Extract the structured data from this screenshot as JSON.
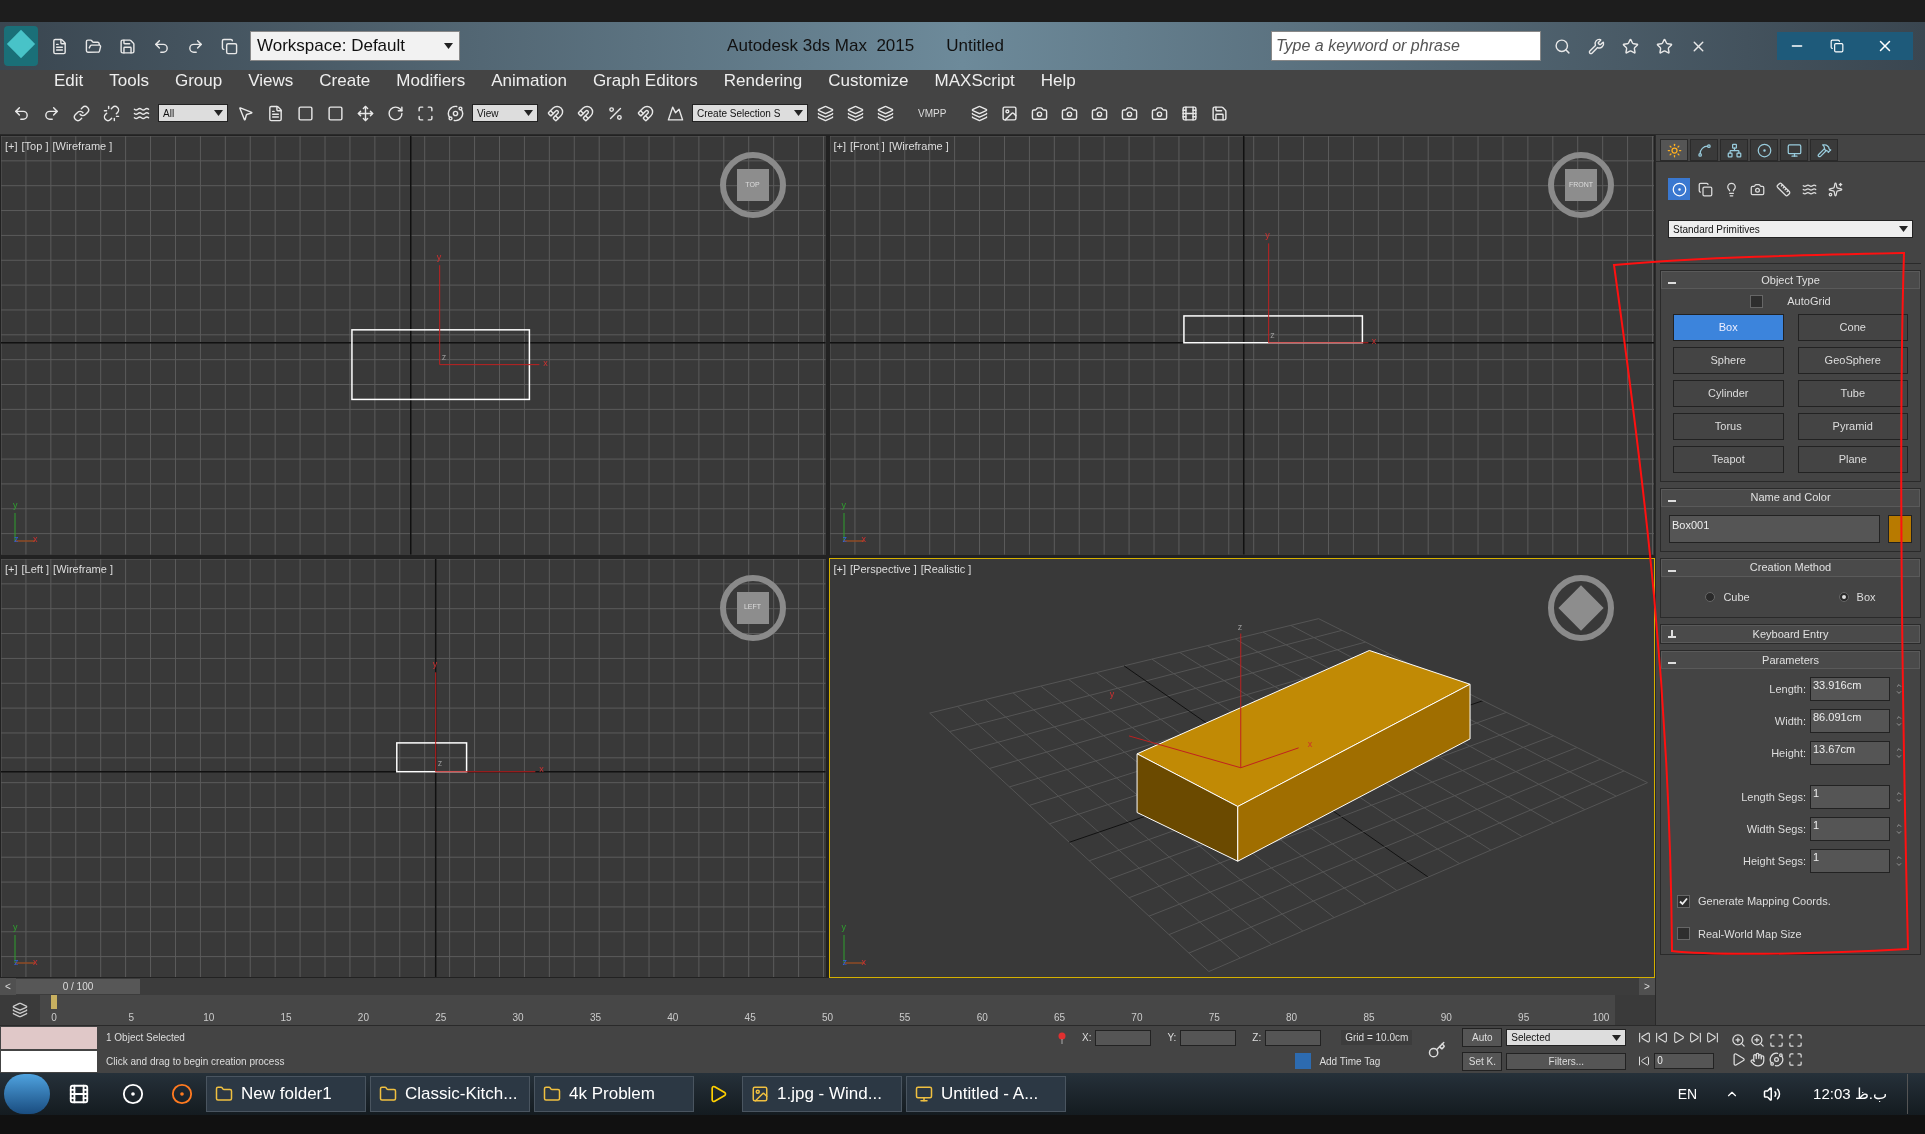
{
  "title_bar": {
    "workspace": "Workspace: Default",
    "app": "Autodesk 3ds Max  2015",
    "document": "Untitled",
    "search": {
      "placeholder": "Type a keyword or phrase"
    }
  },
  "menu": [
    "Edit",
    "Tools",
    "Group",
    "Views",
    "Create",
    "Modifiers",
    "Animation",
    "Graph Editors",
    "Rendering",
    "Customize",
    "MAXScript",
    "Help"
  ],
  "toolbar": {
    "filter": "All",
    "coord": "View",
    "selection_set": "Create Selection S",
    "vmpp": "VMPP"
  },
  "viewports": [
    {
      "kind": "top",
      "labels": [
        "[+]",
        "[Top ]",
        "[Wireframe ]"
      ],
      "cube": "TOP",
      "gizmo_labels": [
        "x",
        "y",
        "z"
      ],
      "corner_labels": [
        "x",
        "y",
        "z"
      ],
      "selected": false
    },
    {
      "kind": "front",
      "labels": [
        "[+]",
        "[Front ]",
        "[Wireframe ]"
      ],
      "cube": "FRONT",
      "gizmo_labels": [
        "x",
        "y",
        "z"
      ],
      "corner_labels": [
        "x",
        "y",
        "z"
      ],
      "selected": false
    },
    {
      "kind": "left",
      "labels": [
        "[+]",
        "[Left ]",
        "[Wireframe ]"
      ],
      "cube": "LEFT",
      "gizmo_labels": [
        "x",
        "y",
        "z"
      ],
      "corner_labels": [
        "x",
        "y",
        "z"
      ],
      "selected": false
    },
    {
      "kind": "perspective",
      "labels": [
        "[+]",
        "[Perspective ]",
        "[Realistic ]"
      ],
      "gizmo_labels": [
        "x",
        "y",
        "z"
      ],
      "corner_labels": [
        "x",
        "y",
        "z"
      ],
      "selected": true
    }
  ],
  "command_panel": {
    "tabs": [
      {
        "kind": "create",
        "selected": true
      },
      {
        "kind": "modify",
        "selected": false
      },
      {
        "kind": "hierarchy",
        "selected": false
      },
      {
        "kind": "motion",
        "selected": false
      },
      {
        "kind": "display",
        "selected": false
      },
      {
        "kind": "utilities",
        "selected": false
      }
    ],
    "categories": [
      {
        "kind": "geometry",
        "selected": true
      },
      {
        "kind": "shapes",
        "selected": false
      },
      {
        "kind": "lights",
        "selected": false
      },
      {
        "kind": "cameras",
        "selected": false
      },
      {
        "kind": "helpers",
        "selected": false
      },
      {
        "kind": "spacewarps",
        "selected": false
      },
      {
        "kind": "systems",
        "selected": false
      }
    ],
    "dropdown": "Standard Primitives",
    "object_type": {
      "title": "Object Type",
      "expanded": true,
      "autogrid": {
        "label": "AutoGrid",
        "checked": false
      },
      "buttons": [
        {
          "label": "Box",
          "selected": true
        },
        {
          "label": "Cone",
          "selected": false
        },
        {
          "label": "Sphere",
          "selected": false
        },
        {
          "label": "GeoSphere",
          "selected": false
        },
        {
          "label": "Cylinder",
          "selected": false
        },
        {
          "label": "Tube",
          "selected": false
        },
        {
          "label": "Torus",
          "selected": false
        },
        {
          "label": "Pyramid",
          "selected": false
        },
        {
          "label": "Teapot",
          "selected": false
        },
        {
          "label": "Plane",
          "selected": false
        }
      ]
    },
    "name_and_color": {
      "title": "Name and Color",
      "expanded": true,
      "name": "Box001",
      "color": "#b87a00"
    },
    "creation_method": {
      "title": "Creation Method",
      "expanded": true,
      "options": [
        {
          "label": "Cube",
          "selected": false
        },
        {
          "label": "Box",
          "selected": true
        }
      ]
    },
    "keyboard_entry": {
      "title": "Keyboard Entry",
      "expanded": false
    },
    "parameters": {
      "title": "Parameters",
      "expanded": true,
      "fields": [
        {
          "label": "Length:",
          "value": "33.916cm"
        },
        {
          "label": "Width:",
          "value": "86.091cm"
        },
        {
          "label": "Height:",
          "value": "13.67cm"
        },
        {
          "label": "Length Segs:",
          "value": "1"
        },
        {
          "label": "Width Segs:",
          "value": "1"
        },
        {
          "label": "Height Segs:",
          "value": "1"
        }
      ],
      "checkboxes": [
        {
          "label": "Generate Mapping Coords.",
          "checked": true
        },
        {
          "label": "Real-World Map Size",
          "checked": false
        }
      ]
    }
  },
  "timeline": {
    "frame": "0 / 100",
    "level": 0,
    "prev": "<",
    "next": ">",
    "ticks": [
      "0",
      "5",
      "10",
      "15",
      "20",
      "25",
      "30",
      "35",
      "40",
      "45",
      "50",
      "55",
      "60",
      "65",
      "70",
      "75",
      "80",
      "85",
      "90",
      "95",
      "100"
    ]
  },
  "status": {
    "selected": "1 Object Selected",
    "prompt": "Click and drag to begin creation process",
    "x": "X:",
    "y": "Y:",
    "z": "Z:",
    "grid": "Grid = 10.0cm",
    "add_time_tag": "Add Time Tag",
    "auto": "Auto",
    "set_key": "Set K.",
    "key_filter": "Selected",
    "filters": "Filters...",
    "frame": "0"
  },
  "taskbar": {
    "items": [
      {
        "kind": "folder",
        "label": "New folder1"
      },
      {
        "kind": "folder",
        "label": "Classic-Kitch..."
      },
      {
        "kind": "folder",
        "label": "4k Problem"
      },
      {
        "kind": "viewer",
        "label": "1.jpg - Wind..."
      },
      {
        "kind": "max",
        "label": "Untitled - A..."
      }
    ],
    "language": "EN",
    "time": "12:03 ب.ظ"
  }
}
